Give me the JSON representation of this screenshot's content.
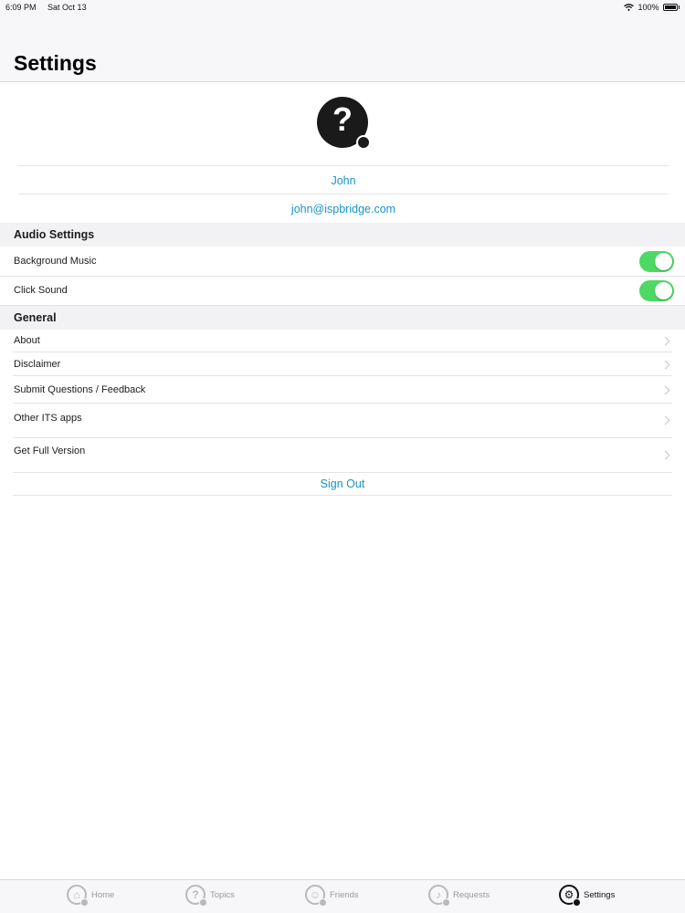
{
  "status_bar": {
    "time": "6:09 PM",
    "date": "Sat Oct 13",
    "battery": "100%"
  },
  "header": {
    "title": "Settings"
  },
  "profile": {
    "name": "John",
    "email": "john@ispbridge.com"
  },
  "audio_settings": {
    "title": "Audio Settings",
    "items": [
      {
        "label": "Background Music",
        "on": true
      },
      {
        "label": "Click Sound",
        "on": true
      }
    ]
  },
  "general": {
    "title": "General",
    "items": [
      {
        "label": "About"
      },
      {
        "label": "Disclaimer"
      },
      {
        "label": "Submit Questions / Feedback"
      },
      {
        "label": "Other ITS apps"
      },
      {
        "label": "Get Full Version"
      }
    ]
  },
  "sign_out": {
    "label": "Sign Out"
  },
  "tab_bar": {
    "tabs": [
      {
        "label": "Home",
        "icon": "home-icon",
        "active": false
      },
      {
        "label": "Topics",
        "icon": "question-icon",
        "active": false
      },
      {
        "label": "Friends",
        "icon": "person-icon",
        "active": false
      },
      {
        "label": "Requests",
        "icon": "bell-icon",
        "active": false
      },
      {
        "label": "Settings",
        "icon": "gear-icon",
        "active": true
      }
    ]
  },
  "colors": {
    "accent": "#1a93c9",
    "toggle_on": "#4cd964"
  }
}
